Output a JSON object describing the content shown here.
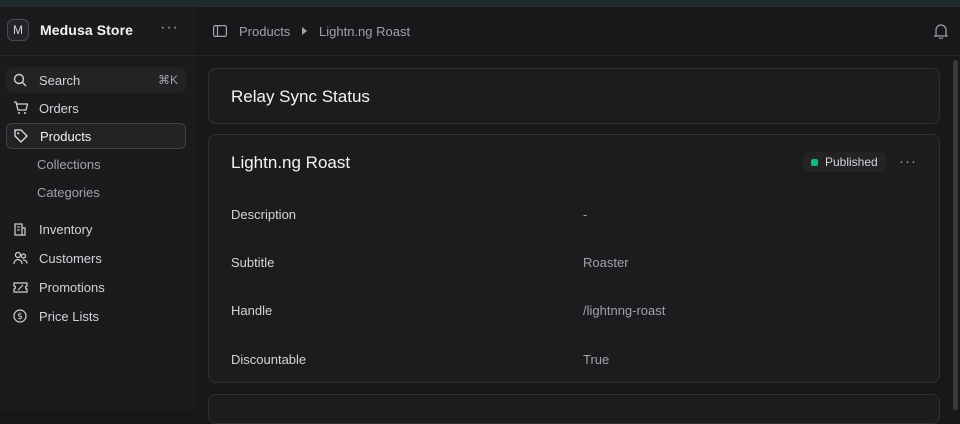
{
  "store": {
    "avatar_letter": "M",
    "name": "Medusa Store",
    "more": "···"
  },
  "search": {
    "label": "Search",
    "shortcut": "⌘K"
  },
  "nav": {
    "orders": "Orders",
    "products": "Products",
    "collections": "Collections",
    "categories": "Categories",
    "inventory": "Inventory",
    "customers": "Customers",
    "promotions": "Promotions",
    "price_lists": "Price Lists"
  },
  "breadcrumb": {
    "parent": "Products",
    "current": "Lightn.ng Roast"
  },
  "sync_card": {
    "title": "Relay Sync Status"
  },
  "product": {
    "title": "Lightn.ng Roast",
    "status": "Published",
    "status_color": "#10b981",
    "more": "···",
    "fields": [
      {
        "label": "Description",
        "value": "-"
      },
      {
        "label": "Subtitle",
        "value": "Roaster"
      },
      {
        "label": "Handle",
        "value": "/lightnng-roast"
      },
      {
        "label": "Discountable",
        "value": "True"
      }
    ]
  }
}
